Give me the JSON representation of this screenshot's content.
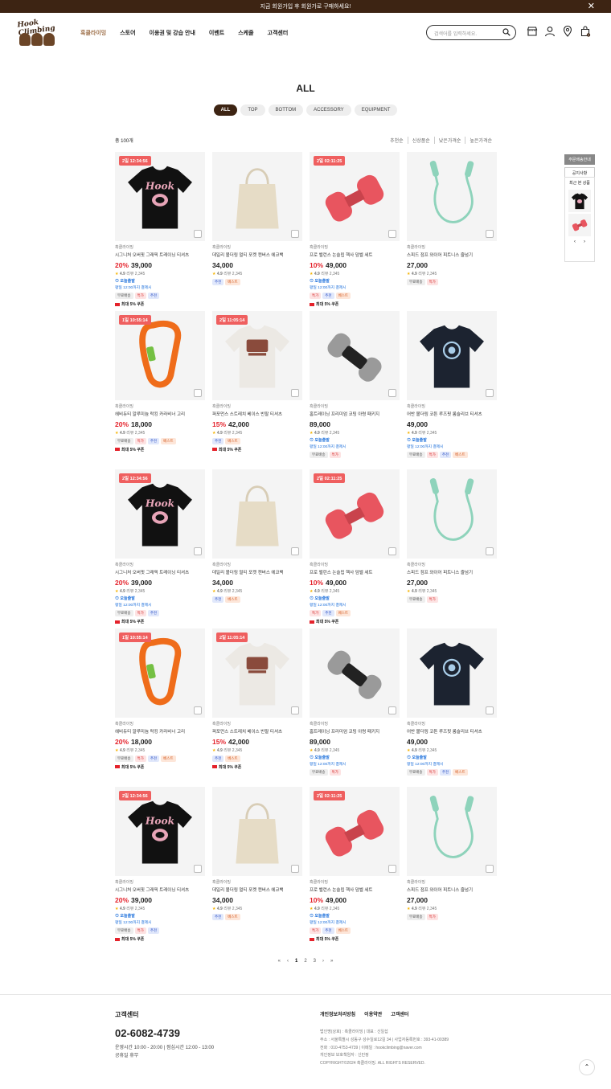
{
  "banner": {
    "text": "지금 회원가입 후 회원가로 구매하세요!",
    "close_icon": "close-icon"
  },
  "header": {
    "logo_text": "Hook Climbing",
    "nav": [
      "훅클라이밍",
      "스토어",
      "이용권 및 강습 안내",
      "이벤트",
      "스케줄",
      "고객센터"
    ],
    "search_placeholder": "검색어를 입력하세요.",
    "icons": [
      "store-icon",
      "user-icon",
      "location-icon",
      "cart-icon"
    ],
    "cart_count": "0"
  },
  "page_title": "ALL",
  "filters": [
    "ALL",
    "TOP",
    "BOTTOM",
    "ACCESSORY",
    "EQUIPMENT"
  ],
  "count_label": "총 100개",
  "sorts": [
    "추천순",
    "신상품순",
    "낮은가격순",
    "높은가격순"
  ],
  "side": {
    "btn1": "주문배송안내",
    "btn2": "공지사항",
    "recent_title": "최근 본 상품",
    "prev": "‹",
    "next": "›"
  },
  "products": [
    {
      "img": "tee-black",
      "badge": "2일 12:34:56",
      "brand": "훅클라이밍",
      "name": "시그니처 오버핏 그래픽 트레이닝 티셔츠",
      "pct": "20%",
      "price": "39,000",
      "rating": "4.9",
      "reviews": "리뷰 2,345",
      "ship": "오늘출발",
      "shipsub": "평일 12:00까지 결제시",
      "tags": [
        [
          "무료배송",
          "t0"
        ],
        [
          "특가",
          "t1"
        ],
        [
          "추천",
          "t2"
        ]
      ],
      "coupon": "최대 5% 쿠폰"
    },
    {
      "img": "tote",
      "badge": "",
      "brand": "훅클라이밍",
      "name": "데일리 볼더링 멀티 포켓 캔버스 에코백",
      "pct": "",
      "price": "34,000",
      "rating": "4.9",
      "reviews": "리뷰 2,345",
      "ship": "",
      "shipsub": "",
      "tags": [
        [
          "추천",
          "t2"
        ],
        [
          "베스트",
          "t3"
        ]
      ],
      "coupon": ""
    },
    {
      "img": "dumbbell-red",
      "badge": "2일 02:11:25",
      "brand": "훅클라이밍",
      "name": "프로 밸런스 논슬립 헥사 덤벨 세트",
      "pct": "10%",
      "price": "49,000",
      "rating": "4.9",
      "reviews": "리뷰 2,345",
      "ship": "오늘출발",
      "shipsub": "평일 12:00까지 결제시",
      "tags": [
        [
          "특가",
          "t1"
        ],
        [
          "추천",
          "t2"
        ],
        [
          "베스트",
          "t3"
        ]
      ],
      "coupon": "최대 5% 쿠폰"
    },
    {
      "img": "rope",
      "badge": "",
      "brand": "훅클라이밍",
      "name": "스피드 점프 와이어 피트니스 줄넘기",
      "pct": "",
      "price": "27,000",
      "rating": "4.9",
      "reviews": "리뷰 2,345",
      "ship": "",
      "shipsub": "",
      "tags": [
        [
          "무료배송",
          "t0"
        ],
        [
          "특가",
          "t1"
        ]
      ],
      "coupon": ""
    },
    {
      "img": "carabiner",
      "badge": "1일 10:55:14",
      "brand": "훅클라이밍",
      "name": "헤비듀티 알루미늄 락킹 카라비너 고리",
      "pct": "20%",
      "price": "18,000",
      "rating": "4.9",
      "reviews": "리뷰 2,345",
      "ship": "",
      "shipsub": "",
      "tags": [
        [
          "무료배송",
          "t0"
        ],
        [
          "특가",
          "t1"
        ],
        [
          "추천",
          "t2"
        ],
        [
          "베스트",
          "t3"
        ]
      ],
      "coupon": "최대 5% 쿠폰"
    },
    {
      "img": "tee-white",
      "badge": "2일 11:05:14",
      "brand": "훅클라이밍",
      "name": "퍼포먼스 스트레치 베이스 반팔 티셔츠",
      "pct": "15%",
      "price": "42,000",
      "rating": "4.9",
      "reviews": "리뷰 2,345",
      "ship": "",
      "shipsub": "",
      "tags": [
        [
          "추천",
          "t2"
        ],
        [
          "베스트",
          "t3"
        ]
      ],
      "coupon": "최대 5% 쿠폰"
    },
    {
      "img": "dumbbell-grey",
      "badge": "",
      "brand": "훅클라이밍",
      "name": "홈트레이닝 프리미엄 코팅 아령 패키지",
      "pct": "",
      "price": "89,000",
      "rating": "4.9",
      "reviews": "리뷰 2,345",
      "ship": "오늘출발",
      "shipsub": "평일 12:00까지 결제시",
      "tags": [
        [
          "무료배송",
          "t0"
        ],
        [
          "특가",
          "t1"
        ]
      ],
      "coupon": ""
    },
    {
      "img": "tee-navy",
      "badge": "",
      "brand": "훅클라이밍",
      "name": "어반 볼더링 코튼 루즈핏 롱슬리브 티셔츠",
      "pct": "",
      "price": "49,000",
      "rating": "4.9",
      "reviews": "리뷰 2,345",
      "ship": "오늘출발",
      "shipsub": "평일 12:00까지 결제시",
      "tags": [
        [
          "무료배송",
          "t0"
        ],
        [
          "특가",
          "t1"
        ],
        [
          "추천",
          "t2"
        ],
        [
          "베스트",
          "t3"
        ]
      ],
      "coupon": ""
    },
    {
      "img": "tee-black",
      "badge": "2일 12:34:56",
      "brand": "훅클라이밍",
      "name": "시그니처 오버핏 그래픽 트레이닝 티셔츠",
      "pct": "20%",
      "price": "39,000",
      "rating": "4.9",
      "reviews": "리뷰 2,345",
      "ship": "오늘출발",
      "shipsub": "평일 12:00까지 결제시",
      "tags": [
        [
          "무료배송",
          "t0"
        ],
        [
          "특가",
          "t1"
        ],
        [
          "추천",
          "t2"
        ]
      ],
      "coupon": "최대 5% 쿠폰"
    },
    {
      "img": "tote",
      "badge": "",
      "brand": "훅클라이밍",
      "name": "데일리 볼더링 멀티 포켓 캔버스 에코백",
      "pct": "",
      "price": "34,000",
      "rating": "4.9",
      "reviews": "리뷰 2,345",
      "ship": "",
      "shipsub": "",
      "tags": [
        [
          "추천",
          "t2"
        ],
        [
          "베스트",
          "t3"
        ]
      ],
      "coupon": ""
    },
    {
      "img": "dumbbell-red",
      "badge": "2일 02:11:25",
      "brand": "훅클라이밍",
      "name": "프로 밸런스 논슬립 헥사 덤벨 세트",
      "pct": "10%",
      "price": "49,000",
      "rating": "4.9",
      "reviews": "리뷰 2,345",
      "ship": "오늘출발",
      "shipsub": "평일 12:00까지 결제시",
      "tags": [
        [
          "특가",
          "t1"
        ],
        [
          "추천",
          "t2"
        ],
        [
          "베스트",
          "t3"
        ]
      ],
      "coupon": "최대 5% 쿠폰"
    },
    {
      "img": "rope",
      "badge": "",
      "brand": "훅클라이밍",
      "name": "스피드 점프 와이어 피트니스 줄넘기",
      "pct": "",
      "price": "27,000",
      "rating": "4.9",
      "reviews": "리뷰 2,345",
      "ship": "",
      "shipsub": "",
      "tags": [
        [
          "무료배송",
          "t0"
        ],
        [
          "특가",
          "t1"
        ]
      ],
      "coupon": ""
    },
    {
      "img": "carabiner",
      "badge": "1일 10:55:14",
      "brand": "훅클라이밍",
      "name": "헤비듀티 알루미늄 락킹 카라비너 고리",
      "pct": "20%",
      "price": "18,000",
      "rating": "4.9",
      "reviews": "리뷰 2,345",
      "ship": "",
      "shipsub": "",
      "tags": [
        [
          "무료배송",
          "t0"
        ],
        [
          "특가",
          "t1"
        ],
        [
          "추천",
          "t2"
        ],
        [
          "베스트",
          "t3"
        ]
      ],
      "coupon": "최대 5% 쿠폰"
    },
    {
      "img": "tee-white",
      "badge": "2일 11:05:14",
      "brand": "훅클라이밍",
      "name": "퍼포먼스 스트레치 베이스 반팔 티셔츠",
      "pct": "15%",
      "price": "42,000",
      "rating": "4.9",
      "reviews": "리뷰 2,345",
      "ship": "",
      "shipsub": "",
      "tags": [
        [
          "추천",
          "t2"
        ],
        [
          "베스트",
          "t3"
        ]
      ],
      "coupon": "최대 5% 쿠폰"
    },
    {
      "img": "dumbbell-grey",
      "badge": "",
      "brand": "훅클라이밍",
      "name": "홈트레이닝 프리미엄 코팅 아령 패키지",
      "pct": "",
      "price": "89,000",
      "rating": "4.9",
      "reviews": "리뷰 2,345",
      "ship": "오늘출발",
      "shipsub": "평일 12:00까지 결제시",
      "tags": [
        [
          "무료배송",
          "t0"
        ],
        [
          "특가",
          "t1"
        ]
      ],
      "coupon": ""
    },
    {
      "img": "tee-navy",
      "badge": "",
      "brand": "훅클라이밍",
      "name": "어반 볼더링 코튼 루즈핏 롱슬리브 티셔츠",
      "pct": "",
      "price": "49,000",
      "rating": "4.9",
      "reviews": "리뷰 2,345",
      "ship": "오늘출발",
      "shipsub": "평일 12:00까지 결제시",
      "tags": [
        [
          "무료배송",
          "t0"
        ],
        [
          "특가",
          "t1"
        ],
        [
          "추천",
          "t2"
        ],
        [
          "베스트",
          "t3"
        ]
      ],
      "coupon": ""
    },
    {
      "img": "tee-black",
      "badge": "2일 12:34:56",
      "brand": "훅클라이밍",
      "name": "시그니처 오버핏 그래픽 트레이닝 티셔츠",
      "pct": "20%",
      "price": "39,000",
      "rating": "4.9",
      "reviews": "리뷰 2,345",
      "ship": "오늘출발",
      "shipsub": "평일 12:00까지 결제시",
      "tags": [
        [
          "무료배송",
          "t0"
        ],
        [
          "특가",
          "t1"
        ],
        [
          "추천",
          "t2"
        ]
      ],
      "coupon": "최대 5% 쿠폰"
    },
    {
      "img": "tote",
      "badge": "",
      "brand": "훅클라이밍",
      "name": "데일리 볼더링 멀티 포켓 캔버스 에코백",
      "pct": "",
      "price": "34,000",
      "rating": "4.9",
      "reviews": "리뷰 2,345",
      "ship": "",
      "shipsub": "",
      "tags": [
        [
          "추천",
          "t2"
        ],
        [
          "베스트",
          "t3"
        ]
      ],
      "coupon": ""
    },
    {
      "img": "dumbbell-red",
      "badge": "2일 02:11:25",
      "brand": "훅클라이밍",
      "name": "프로 밸런스 논슬립 헥사 덤벨 세트",
      "pct": "10%",
      "price": "49,000",
      "rating": "4.9",
      "reviews": "리뷰 2,345",
      "ship": "오늘출발",
      "shipsub": "평일 12:00까지 결제시",
      "tags": [
        [
          "특가",
          "t1"
        ],
        [
          "추천",
          "t2"
        ],
        [
          "베스트",
          "t3"
        ]
      ],
      "coupon": "최대 5% 쿠폰"
    },
    {
      "img": "rope",
      "badge": "",
      "brand": "훅클라이밍",
      "name": "스피드 점프 와이어 피트니스 줄넘기",
      "pct": "",
      "price": "27,000",
      "rating": "4.9",
      "reviews": "리뷰 2,345",
      "ship": "",
      "shipsub": "",
      "tags": [
        [
          "무료배송",
          "t0"
        ],
        [
          "특가",
          "t1"
        ]
      ],
      "coupon": ""
    }
  ],
  "pagination": [
    "«",
    "‹",
    "1",
    "2",
    "3",
    "›",
    "»"
  ],
  "footer": {
    "cs_title": "고객센터",
    "tel": "02-6082-4739",
    "hours1": "운영시간 10:00 - 20:00  |  점심시간 12:00 - 13:00",
    "hours2": "공휴일 휴무",
    "links": [
      "개인정보처리방침",
      "이용약관",
      "고객센터"
    ],
    "info": [
      "법인명(상호) : 훅클라이밍  |  대표 : 신일섭",
      "주소 : 서울특별시 성동구 성수일로12길 34  |  사업자등록번호 : 393-41-00389",
      "전화 : 010-4753-4739  |  이메일 : hookclimbing@naver.com",
      "개인정보 보호책임자 : 신민정",
      "COPYRIGHT©2024 훅클라이밍. ALL RIGHTS RESERVED."
    ],
    "top_button": "⌃"
  }
}
